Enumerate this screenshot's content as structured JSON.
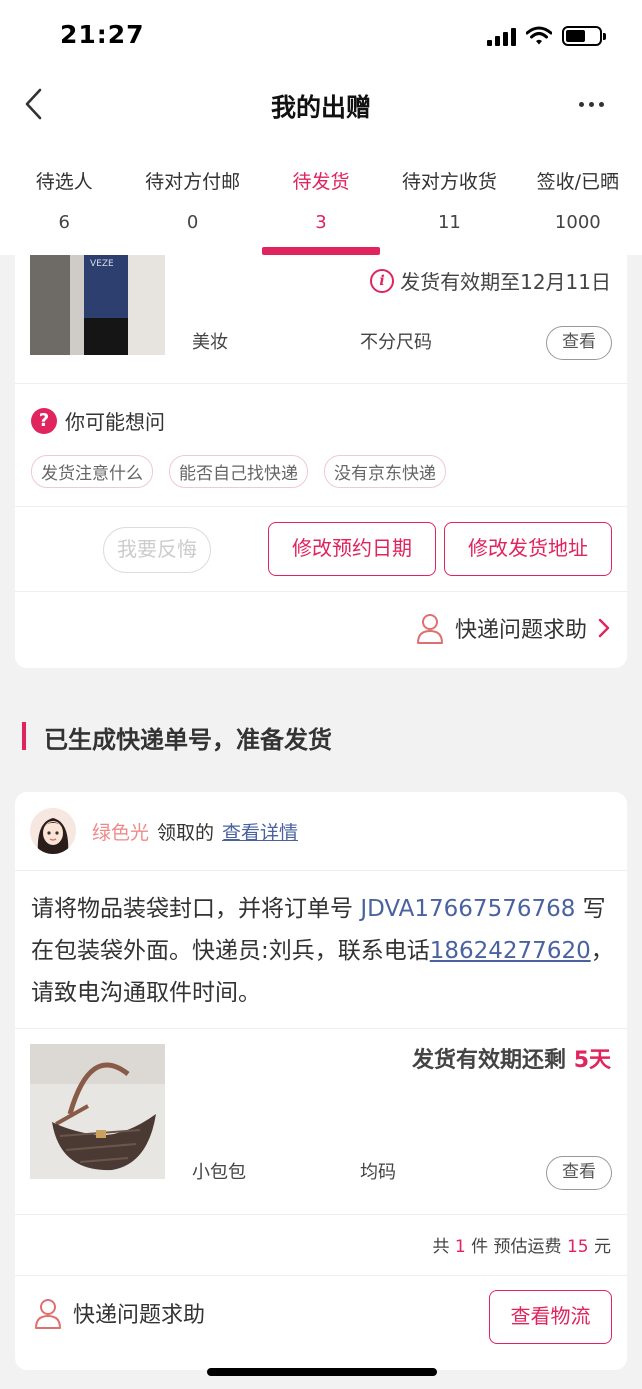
{
  "status_bar": {
    "time": "21:27"
  },
  "nav": {
    "title": "我的出赠",
    "back_icon": "chevron-left-icon",
    "more_icon": "more-dots-icon"
  },
  "tabs": [
    {
      "label": "待选人",
      "count": "6"
    },
    {
      "label": "待对方付邮",
      "count": "0"
    },
    {
      "label": "待发货",
      "count": "3",
      "active": true
    },
    {
      "label": "待对方收货",
      "count": "11"
    },
    {
      "label": "签收/已晒",
      "count": "1000"
    }
  ],
  "card1": {
    "deadline": "发货有效期至12月11日",
    "category": "美妆",
    "size": "不分尺码",
    "view_label": "查看",
    "faq_title": "你可能想问",
    "faq_chips": [
      "发货注意什么",
      "能否自己找快递",
      "没有京东快递"
    ],
    "regret_label": "我要反悔",
    "change_date_label": "修改预约日期",
    "change_address_label": "修改发货地址",
    "help_label": "快递问题求助"
  },
  "section": {
    "title": "已生成快递单号，准备发货"
  },
  "card2": {
    "claimer_name": "绿色光",
    "claimed_text": "领取的",
    "details_link": "查看详情",
    "instruction_prefix": "请将物品装袋封口，并将订单号 ",
    "order_number": "JDVA17667576768",
    "instruction_middle": " 写在包装袋外面。快递员:刘兵，联系电话",
    "phone": "18624277620",
    "instruction_suffix": "，请致电沟通取件时间。",
    "deadline_prefix": "发货有效期还剩 ",
    "deadline_days": "5天",
    "category": "小包包",
    "size": "均码",
    "view_label": "查看",
    "summary_a": "共 ",
    "summary_count": "1",
    "summary_b": " 件 预估运费 ",
    "summary_fee": "15",
    "summary_c": " 元",
    "help_label": "快递问题求助",
    "logistics_label": "查看物流"
  },
  "colors": {
    "accent": "#e0245e",
    "link": "#4a63a0",
    "background": "#f2f2f2"
  }
}
